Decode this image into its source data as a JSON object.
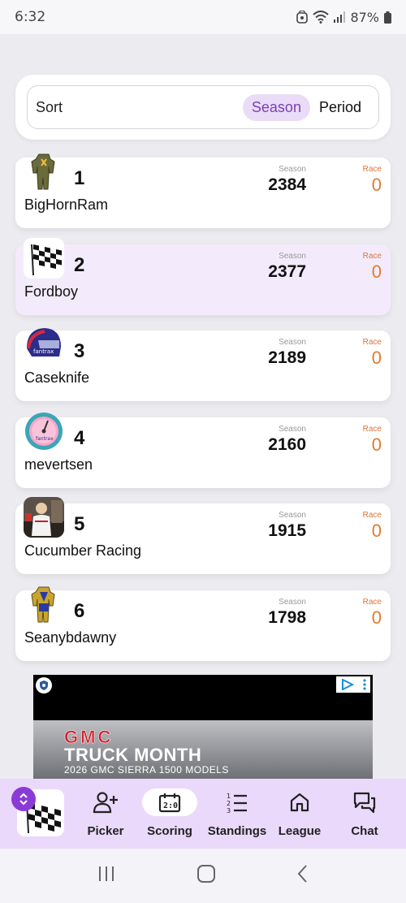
{
  "status_bar": {
    "time": "6:32",
    "battery": "87%"
  },
  "sort": {
    "label": "Sort",
    "options": [
      "Season",
      "Period"
    ],
    "selected": "Season"
  },
  "players": [
    {
      "rank": "1",
      "name": "BigHornRam",
      "season_label": "Season",
      "season": "2384",
      "race_label": "Race",
      "race": "0",
      "avatar": "firesuit-green-icon",
      "highlight": false
    },
    {
      "rank": "2",
      "name": "Fordboy",
      "season_label": "Season",
      "season": "2377",
      "race_label": "Race",
      "race": "0",
      "avatar": "checkered-flag-icon",
      "highlight": true
    },
    {
      "rank": "3",
      "name": "Caseknife",
      "season_label": "Season",
      "season": "2189",
      "race_label": "Race",
      "race": "0",
      "avatar": "helmet-icon",
      "highlight": false
    },
    {
      "rank": "4",
      "name": "mevertsen",
      "season_label": "Season",
      "season": "2160",
      "race_label": "Race",
      "race": "0",
      "avatar": "gauge-icon",
      "highlight": false
    },
    {
      "rank": "5",
      "name": "Cucumber Racing",
      "season_label": "Season",
      "season": "1915",
      "race_label": "Race",
      "race": "0",
      "avatar": "photo-avatar",
      "highlight": false
    },
    {
      "rank": "6",
      "name": "Seanybdawny",
      "season_label": "Season",
      "season": "1798",
      "race_label": "Race",
      "race": "0",
      "avatar": "firesuit-yellow-icon",
      "highlight": false
    }
  ],
  "ad": {
    "brand": "GMC",
    "headline": "TRUCK MONTH",
    "subline": "2026 GMC SIERRA 1500 MODELS"
  },
  "bottom_nav": {
    "items": [
      {
        "label": "Picker",
        "icon": "add-person-icon"
      },
      {
        "label": "Scoring",
        "icon": "scoreboard-icon"
      },
      {
        "label": "Standings",
        "icon": "ranked-list-icon"
      },
      {
        "label": "League",
        "icon": "home-icon"
      },
      {
        "label": "Chat",
        "icon": "chat-bubbles-icon"
      }
    ],
    "active": "Scoring"
  },
  "colors": {
    "accent": "#7a3fb4",
    "nav_bg": "#ead9fa",
    "race_orange": "#e07b2e"
  }
}
